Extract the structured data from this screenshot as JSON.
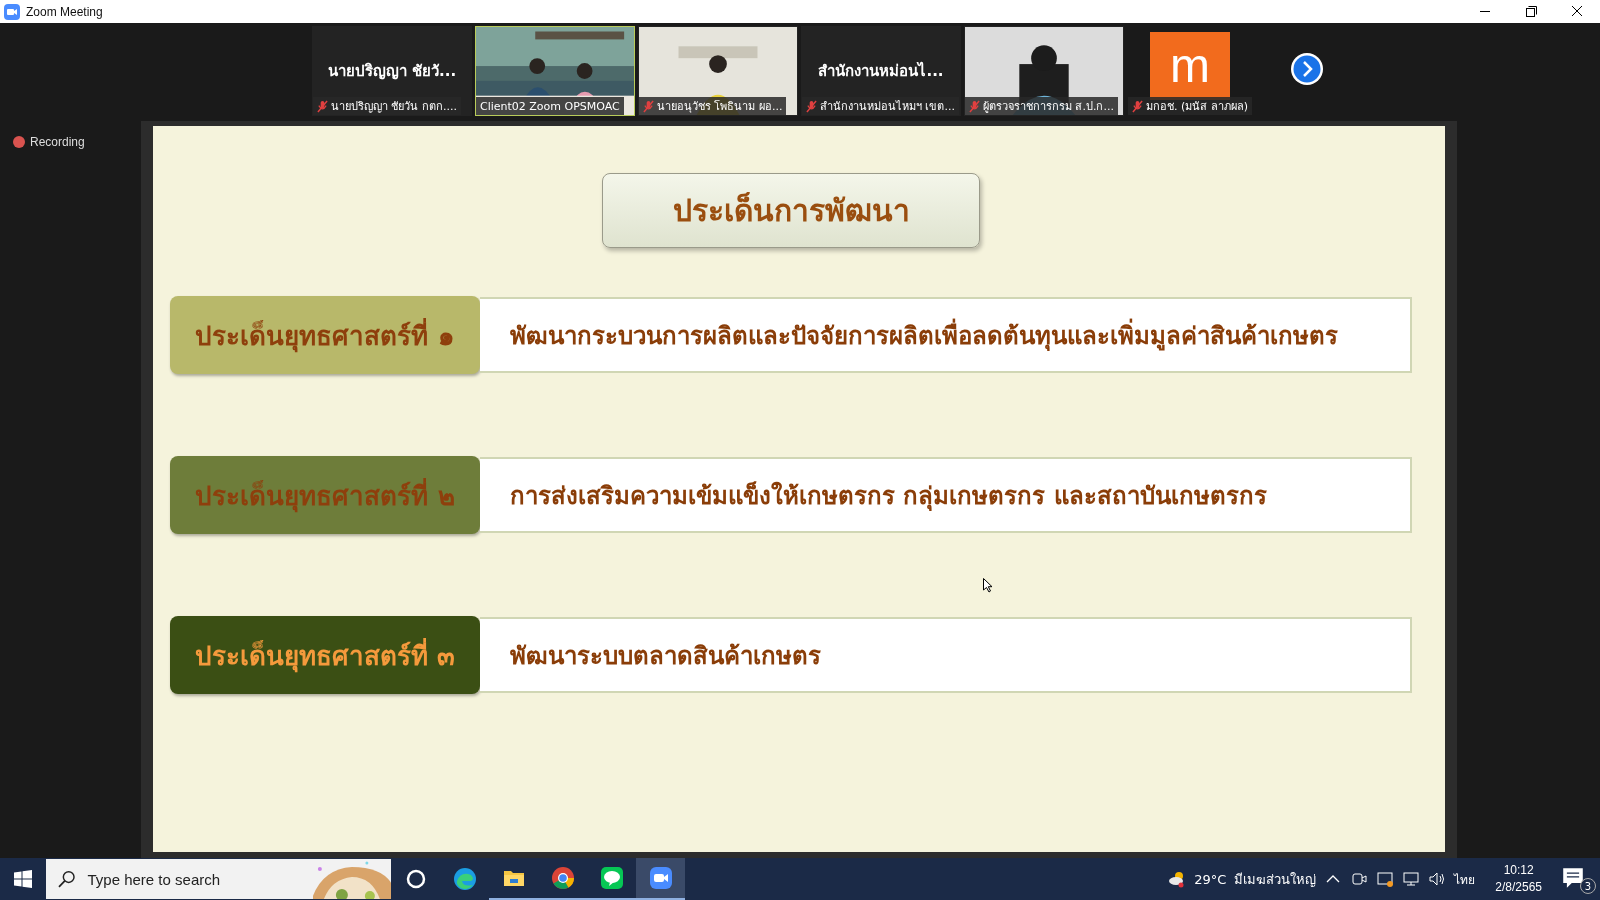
{
  "window": {
    "title": "Zoom Meeting"
  },
  "participants": [
    {
      "kind": "name",
      "display_name": "นายปริญญา ชัยวั...",
      "caption": "นายปริญญา ชัยวัน กตก....",
      "muted": true,
      "speaking": false
    },
    {
      "kind": "video",
      "caption": "Client02 Zoom OPSMOAC",
      "muted": false,
      "speaking": true
    },
    {
      "kind": "video",
      "caption": "นายอนุวัชร  โพธินาม ผอ...",
      "muted": true,
      "speaking": false
    },
    {
      "kind": "name",
      "display_name": "สำนักงานหม่อนไ...",
      "caption": "สำนักงานหม่อนไหมฯ เขต...",
      "muted": true,
      "speaking": false
    },
    {
      "kind": "video",
      "caption": "ผู้ตรวจราชการกรม ส.ป.ก...",
      "muted": true,
      "speaking": false
    },
    {
      "kind": "avatar",
      "letter": "m",
      "caption": "มกอช. (มนัส ลาภผล)",
      "muted": true,
      "speaking": false
    }
  ],
  "recording": {
    "label": "Recording"
  },
  "slide": {
    "title": "ประเด็นการพัฒนา",
    "strategies": [
      {
        "label": "ประเด็นยุทธศาสตร์ที่ ๑",
        "text": "พัฒนากระบวนการผลิตและปัจจัยการผลิตเพื่อลดต้นทุนและเพิ่มมูลค่าสินค้าเกษตร",
        "color": "#b8b86a"
      },
      {
        "label": "ประเด็นยุทธศาสตร์ที่ ๒",
        "text": "การส่งเสริมความเข้มแข็งให้เกษตรกร กลุ่มเกษตรกร และสถาบันเกษตรกร",
        "color": "#6e7d3a"
      },
      {
        "label": "ประเด็นยุทธศาสตร์ที่ ๓",
        "text": "พัฒนาระบบตลาดสินค้าเกษตร",
        "color": "#3b4f14"
      }
    ]
  },
  "taskbar": {
    "search": {
      "placeholder": "Type here to search"
    },
    "apps": [
      {
        "kind": "cortana",
        "running": false,
        "selected": false
      },
      {
        "kind": "edge",
        "running": false,
        "selected": false
      },
      {
        "kind": "explorer",
        "running": true,
        "selected": false
      },
      {
        "kind": "chrome",
        "running": true,
        "selected": false
      },
      {
        "kind": "line",
        "running": true,
        "selected": false
      },
      {
        "kind": "zoom",
        "running": true,
        "selected": true
      }
    ],
    "weather": {
      "temperature": "29°C",
      "condition": "มีเมฆส่วนใหญ่"
    },
    "language": "ไทย",
    "time": "10:12",
    "date": "2/8/2565",
    "notifications": "3"
  }
}
